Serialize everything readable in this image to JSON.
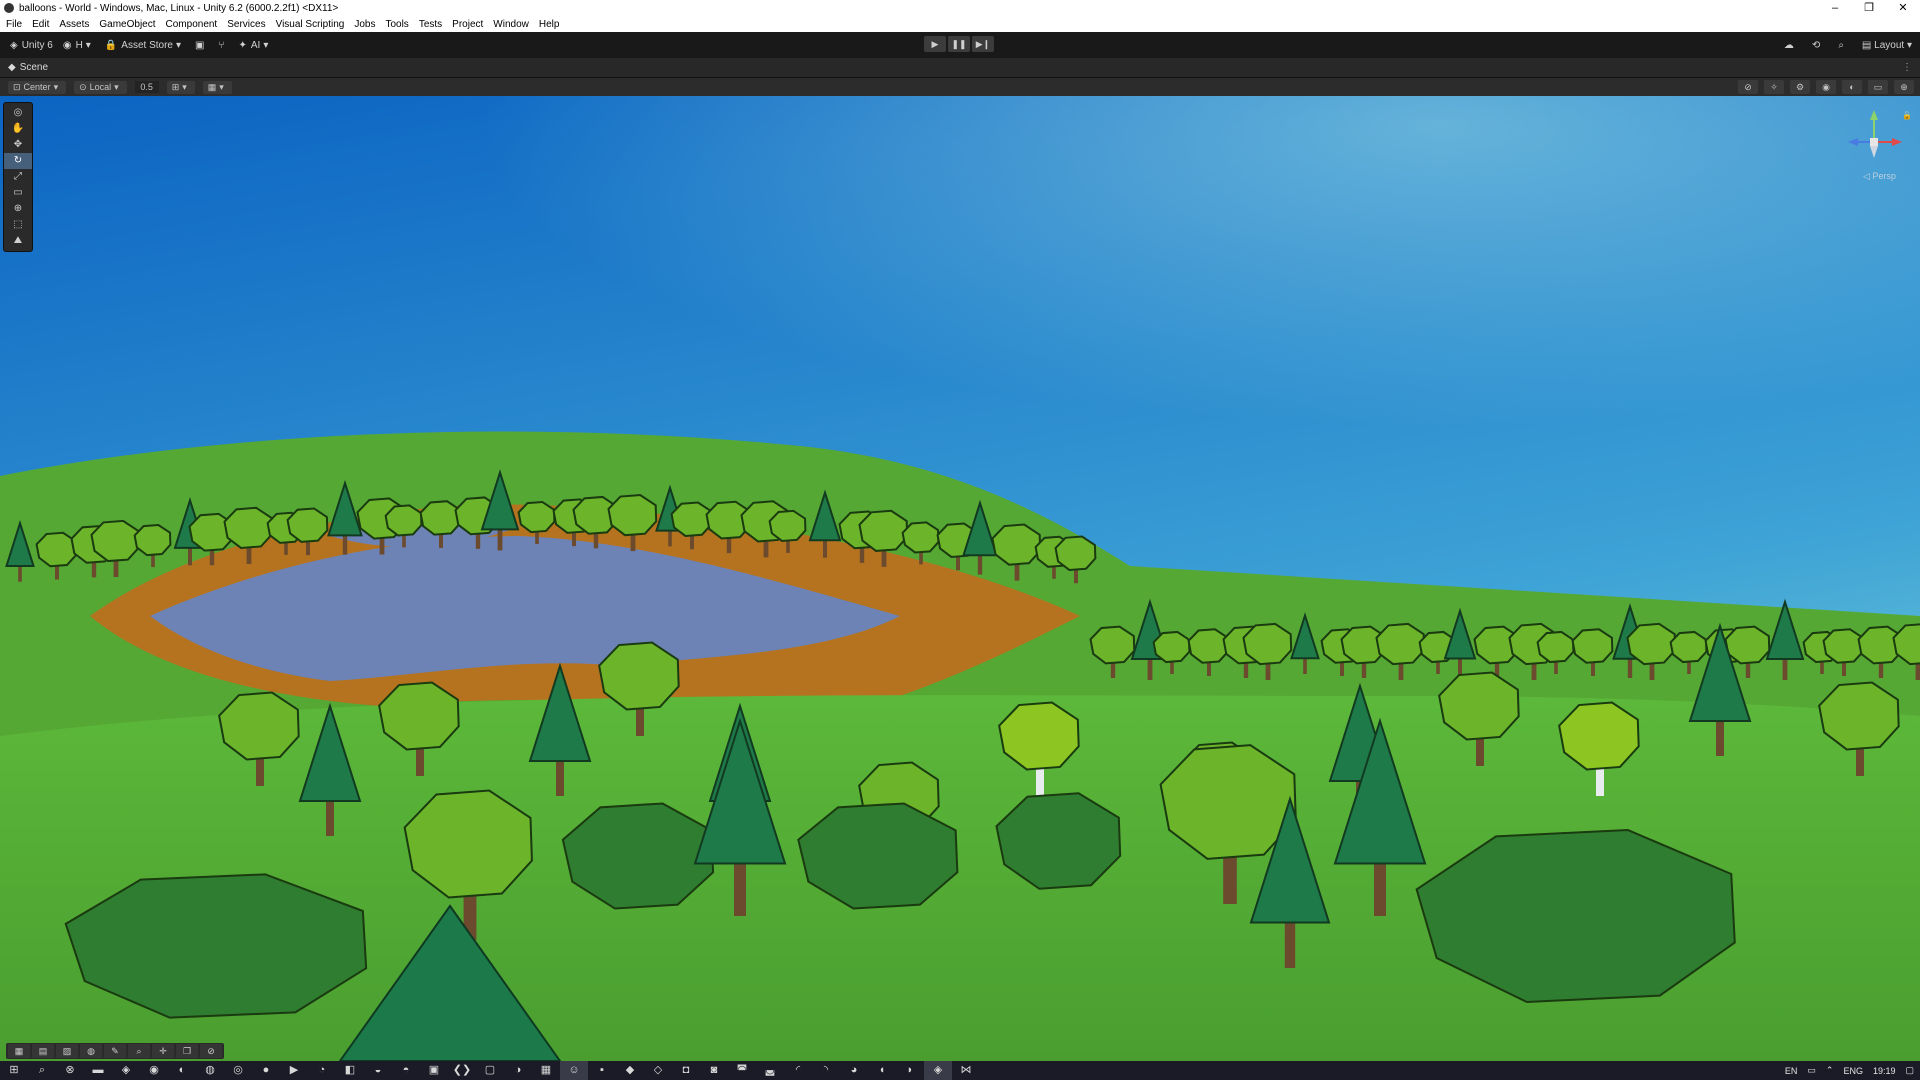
{
  "window": {
    "title": "balloons - World - Windows, Mac, Linux - Unity 6.2 (6000.2.2f1) <DX11>",
    "minimize_glyph": "–",
    "maximize_glyph": "❐",
    "close_glyph": "✕"
  },
  "menu": [
    "File",
    "Edit",
    "Assets",
    "GameObject",
    "Component",
    "Services",
    "Visual Scripting",
    "Jobs",
    "Tools",
    "Tests",
    "Project",
    "Window",
    "Help"
  ],
  "toolbar": {
    "unity_label": "Unity 6",
    "account_label": "H",
    "asset_store_label": "Asset Store",
    "ai_label": "AI",
    "layout_label": "Layout",
    "play_glyph": "▶",
    "pause_glyph": "❚❚",
    "step_glyph": "▶❙"
  },
  "scene_tab": {
    "label": "Scene"
  },
  "scene_toolbar": {
    "pivot_label": "Center",
    "space_label": "Local",
    "snap_value": "0.5"
  },
  "tools": [
    "view-tool",
    "hand-tool",
    "move-tool",
    "rotate-tool",
    "scale-tool",
    "rect-tool",
    "transform-tool",
    "custom-tool",
    "navmesh-tool"
  ],
  "gizmo": {
    "persp_label": "◁ Persp"
  },
  "taskbar": {
    "lang_short": "EN",
    "lang": "ENG",
    "time": "19:19"
  },
  "colors": {
    "sky_top": "#0b64c2",
    "sky_bottom": "#73cfd8",
    "grass": "#52aa33",
    "tree_light": "#8dc622",
    "tree_dark": "#1f7a4a",
    "water": "#6d83b6",
    "soil": "#b5731f"
  }
}
